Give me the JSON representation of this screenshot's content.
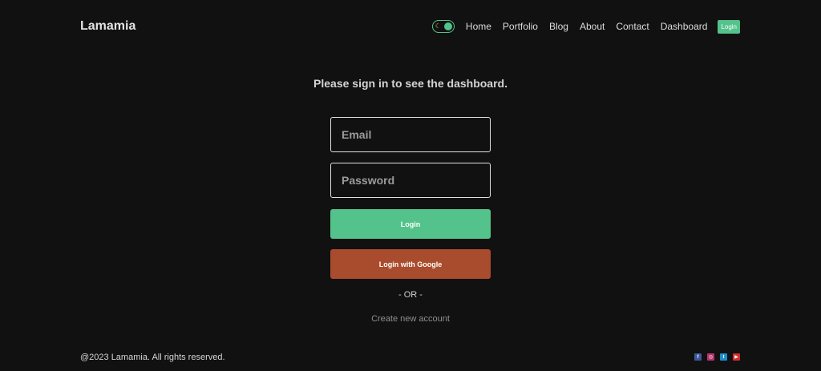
{
  "brand": "Lamamia",
  "nav": {
    "items": [
      {
        "label": "Home"
      },
      {
        "label": "Portfolio"
      },
      {
        "label": "Blog"
      },
      {
        "label": "About"
      },
      {
        "label": "Contact"
      },
      {
        "label": "Dashboard"
      }
    ],
    "login_label": "Login",
    "theme_toggle": {
      "icon": "moon-icon",
      "state": "dark"
    }
  },
  "main": {
    "prompt": "Please sign in to see the dashboard.",
    "email_placeholder": "Email",
    "password_placeholder": "Password",
    "login_button": "Login",
    "google_button": "Login with Google",
    "separator": "- OR -",
    "create_account_link": "Create new account"
  },
  "footer": {
    "copyright": "@2023 Lamamia. All rights reserved.",
    "socials": [
      {
        "icon": "facebook-icon",
        "color": "#3b5998",
        "glyph": "f"
      },
      {
        "icon": "instagram-icon",
        "color": "#b5346f",
        "glyph": "◎"
      },
      {
        "icon": "twitter-icon",
        "color": "#1d8ec9",
        "glyph": "t"
      },
      {
        "icon": "youtube-icon",
        "color": "#d12d2d",
        "glyph": "▶"
      }
    ]
  },
  "colors": {
    "background": "#111111",
    "accent": "#53c28b",
    "google": "#a94c2d"
  }
}
